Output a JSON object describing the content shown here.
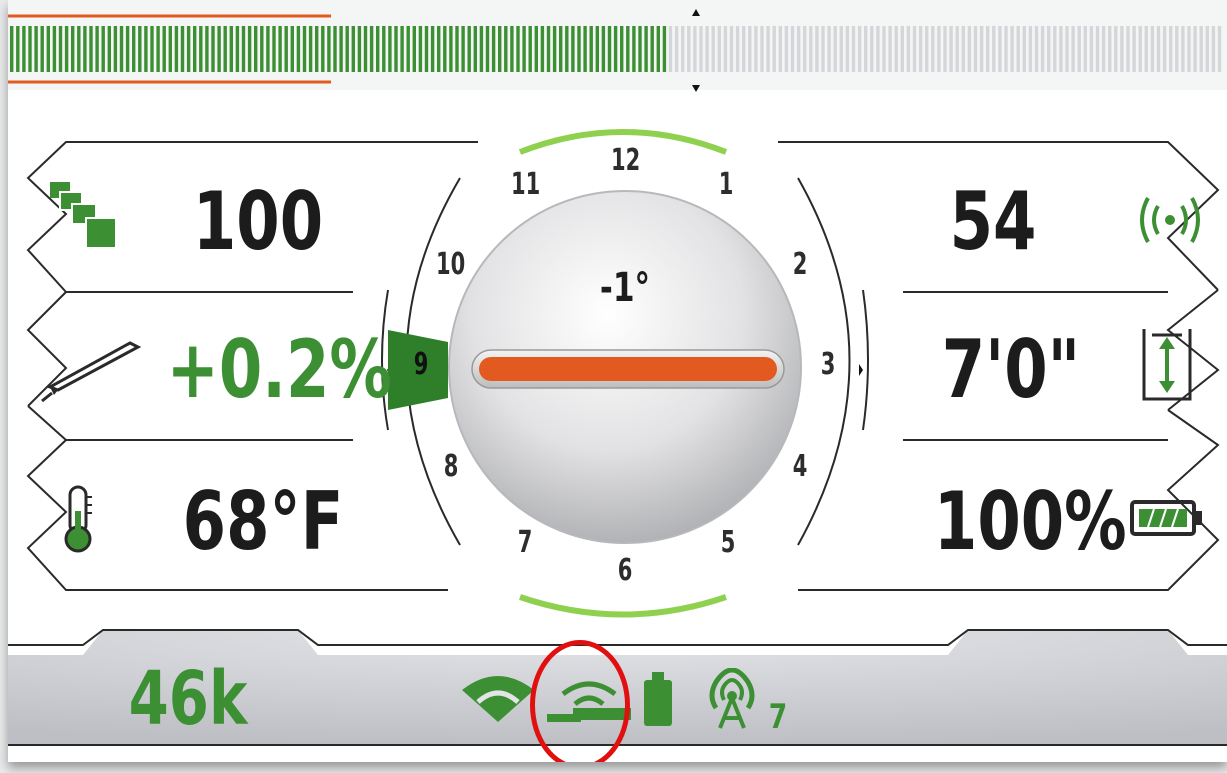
{
  "signal_bar": {
    "filled_fraction": 0.545,
    "progress_fraction": 0.265,
    "fill_color": "#3d8f34",
    "empty_color": "#d5d6d9",
    "progress_color": "#e35a20"
  },
  "left_panel": {
    "depth_count": {
      "value": "100",
      "icon": "stacked-squares-icon"
    },
    "pitch": {
      "value": "+0.2%",
      "icon": "sonde-pitch-icon"
    },
    "temperature": {
      "value": "68°F",
      "icon": "thermometer-icon"
    }
  },
  "right_panel": {
    "signal_strength": {
      "value": "54",
      "icon": "signal-broadcast-icon"
    },
    "depth": {
      "value": "7'0\"",
      "icon": "depth-measure-icon"
    },
    "battery": {
      "value": "100%",
      "icon": "battery-full-icon"
    }
  },
  "roll_dial": {
    "angle_label": "-1°",
    "numbers": [
      "12",
      "1",
      "2",
      "3",
      "4",
      "5",
      "6",
      "7",
      "8",
      "9",
      "10",
      "11"
    ],
    "highlighted": "9",
    "needle_color": "#e35a20",
    "accent_color": "#8fd14f"
  },
  "status_bar": {
    "frequency": "46k",
    "channel": "7",
    "icons": [
      "wifi-icon",
      "remote-link-icon",
      "device-battery-icon",
      "broadcast-tower-icon"
    ],
    "color": "#3d8f34"
  }
}
